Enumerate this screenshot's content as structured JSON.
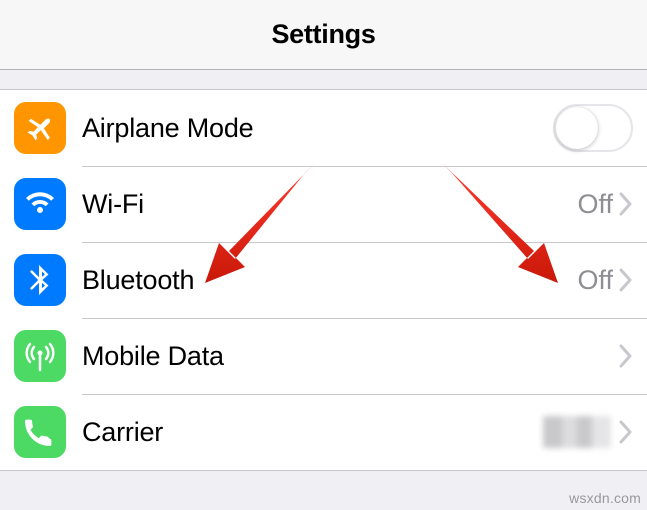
{
  "header": {
    "title": "Settings"
  },
  "rows": {
    "airplane": {
      "label": "Airplane Mode",
      "toggle_on": false,
      "icon_bg": "#ff9500"
    },
    "wifi": {
      "label": "Wi-Fi",
      "value": "Off",
      "icon_bg": "#007aff"
    },
    "bluetooth": {
      "label": "Bluetooth",
      "value": "Off",
      "icon_bg": "#007aff"
    },
    "mobile": {
      "label": "Mobile Data",
      "icon_bg": "#4cd964"
    },
    "carrier": {
      "label": "Carrier",
      "value_obscured": true,
      "icon_bg": "#4cd964"
    }
  },
  "watermark": "wsxdn.com"
}
